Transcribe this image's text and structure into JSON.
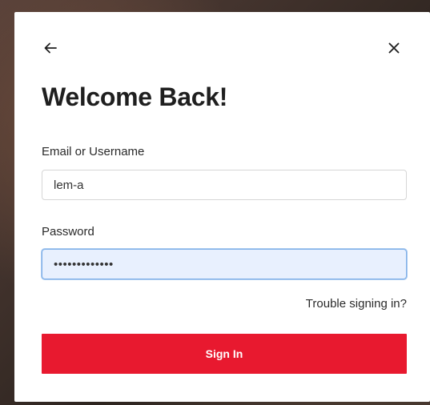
{
  "modal": {
    "title": "Welcome Back!",
    "back_icon": "arrow-left-icon",
    "close_icon": "close-icon"
  },
  "form": {
    "email_label": "Email or Username",
    "email_value": "lem-a",
    "password_label": "Password",
    "password_value": "•••••••••••••",
    "trouble_link": "Trouble signing in?",
    "submit_label": "Sign In"
  },
  "colors": {
    "accent": "#e8192f",
    "focus_bg": "#e8f0fe"
  }
}
